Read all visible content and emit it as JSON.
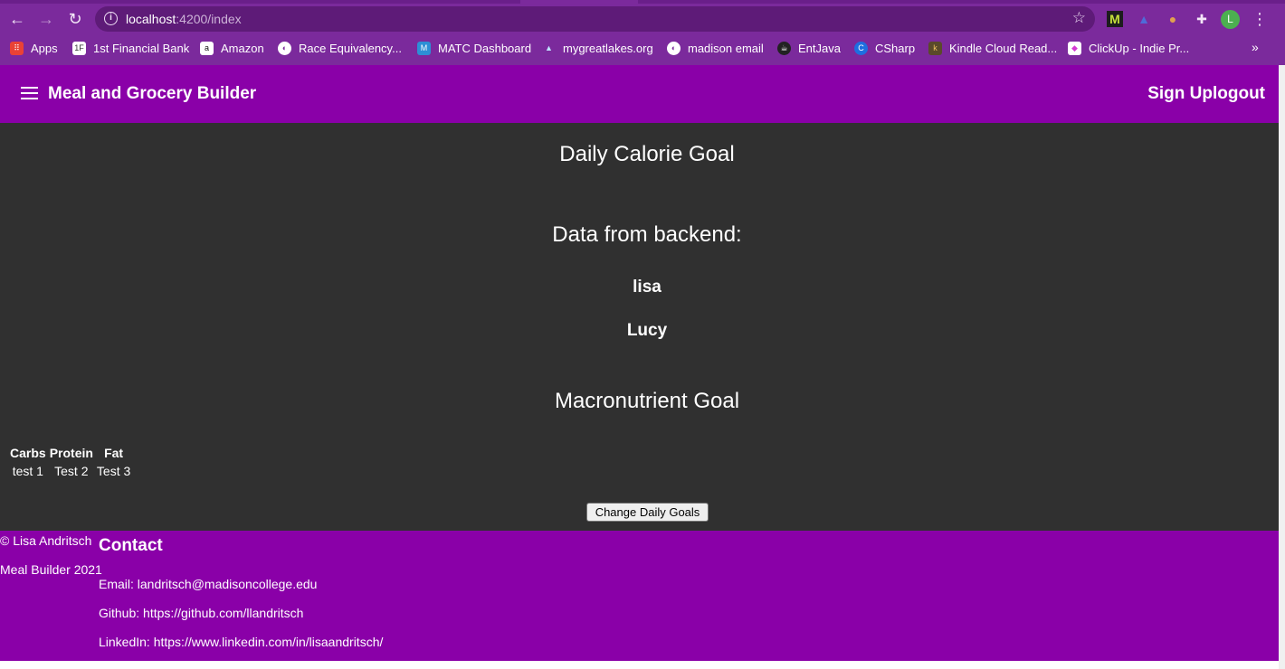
{
  "browser": {
    "url_host": "localhost",
    "url_path": ":4200/index",
    "bookmarks": [
      {
        "label": "Apps",
        "icon": "apps-grid-icon",
        "color": "#e94235"
      },
      {
        "label": "1st Financial Bank",
        "icon": "bank-icon",
        "color": "#444444"
      },
      {
        "label": "Amazon",
        "icon": "amazon-icon",
        "color": "#ffffff"
      },
      {
        "label": "Race Equivalency...",
        "icon": "globe-icon",
        "color": "#ffffff"
      },
      {
        "label": "MATC Dashboard",
        "icon": "matc-icon",
        "color": "#2d8fd5"
      },
      {
        "label": "mygreatlakes.org",
        "icon": "mountain-icon",
        "color": "#1f5f9e"
      },
      {
        "label": "madison email",
        "icon": "globe-icon",
        "color": "#ffffff"
      },
      {
        "label": "EntJava",
        "icon": "entjava-icon",
        "color": "#222222"
      },
      {
        "label": "CSharp",
        "icon": "csharp-icon",
        "color": "#1e6fe0"
      },
      {
        "label": "Kindle Cloud Read...",
        "icon": "kindle-icon",
        "color": "#c88a2c"
      },
      {
        "label": "ClickUp - Indie Pr...",
        "icon": "clickup-icon",
        "color": "#d63ad3"
      }
    ],
    "more": "»",
    "avatar_letter": "L"
  },
  "header": {
    "title": "Meal and Grocery Builder",
    "signup": "Sign Up",
    "logout": "logout"
  },
  "main": {
    "calorie_title": "Daily Calorie Goal",
    "backend_title": "Data from backend:",
    "names": [
      "lisa",
      "Lucy"
    ],
    "macro_title": "Macronutrient Goal",
    "table": {
      "headers": [
        "Carbs",
        "Protein",
        "Fat"
      ],
      "row": [
        "test 1",
        "Test 2",
        "Test 3"
      ]
    },
    "change_button": "Change Daily Goals"
  },
  "footer": {
    "copyright": "© Lisa Andritsch",
    "product": "Meal Builder 2021",
    "contact_title": "Contact",
    "email": "Email: landritsch@madisoncollege.edu",
    "github": "Github: https://github.com/llandritsch",
    "linkedin": "LinkedIn: https://www.linkedin.com/in/lisaandritsch/"
  },
  "colors": {
    "browser_chrome": "#7b2a9c",
    "app_purple": "#8a00a8",
    "main_bg": "#303030"
  }
}
